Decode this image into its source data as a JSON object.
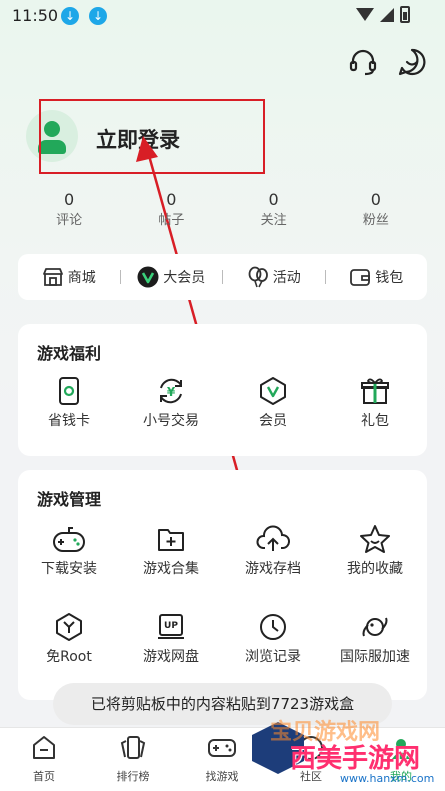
{
  "status_bar": {
    "time": "11:50"
  },
  "header": {
    "login_label": "立即登录"
  },
  "stats": [
    {
      "count": "0",
      "label": "评论"
    },
    {
      "count": "0",
      "label": "帖子"
    },
    {
      "count": "0",
      "label": "关注"
    },
    {
      "count": "0",
      "label": "粉丝"
    }
  ],
  "quick_bar": [
    {
      "label": "商城",
      "icon": "store-icon"
    },
    {
      "label": "大会员",
      "icon": "vip-icon"
    },
    {
      "label": "活动",
      "icon": "balloon-icon"
    },
    {
      "label": "钱包",
      "icon": "wallet-icon"
    }
  ],
  "game_benefits": {
    "title": "游戏福利",
    "items": [
      {
        "label": "省钱卡",
        "icon": "saving-card-icon"
      },
      {
        "label": "小号交易",
        "icon": "yen-exchange-icon"
      },
      {
        "label": "会员",
        "icon": "member-badge-icon"
      },
      {
        "label": "礼包",
        "icon": "gift-icon"
      }
    ]
  },
  "game_management": {
    "title": "游戏管理",
    "items": [
      {
        "label": "下载安装",
        "icon": "gamepad-icon"
      },
      {
        "label": "游戏合集",
        "icon": "folder-plus-icon"
      },
      {
        "label": "游戏存档",
        "icon": "cloud-upload-icon"
      },
      {
        "label": "我的收藏",
        "icon": "star-icon"
      },
      {
        "label": "免Root",
        "icon": "hexagon-y-icon"
      },
      {
        "label": "游戏网盘",
        "icon": "up-drive-icon"
      },
      {
        "label": "浏览记录",
        "icon": "clock-icon"
      },
      {
        "label": "国际服加速",
        "icon": "planet-icon"
      }
    ]
  },
  "toast": {
    "message": "已将剪贴板中的内容粘贴到7723游戏盒"
  },
  "bottom_nav": [
    {
      "label": "首页",
      "icon": "home-icon"
    },
    {
      "label": "排行榜",
      "icon": "ranking-cards-icon"
    },
    {
      "label": "找游戏",
      "icon": "controller-icon"
    },
    {
      "label": "社区",
      "icon": "community-icon"
    },
    {
      "label": "我的",
      "icon": "profile-icon"
    }
  ],
  "watermark": {
    "line1": "宝贝游戏网",
    "line2": "西美手游网",
    "url": "www.hanxm.com"
  },
  "colors": {
    "accent": "#22a85a",
    "annotation_red": "#d81e26"
  }
}
